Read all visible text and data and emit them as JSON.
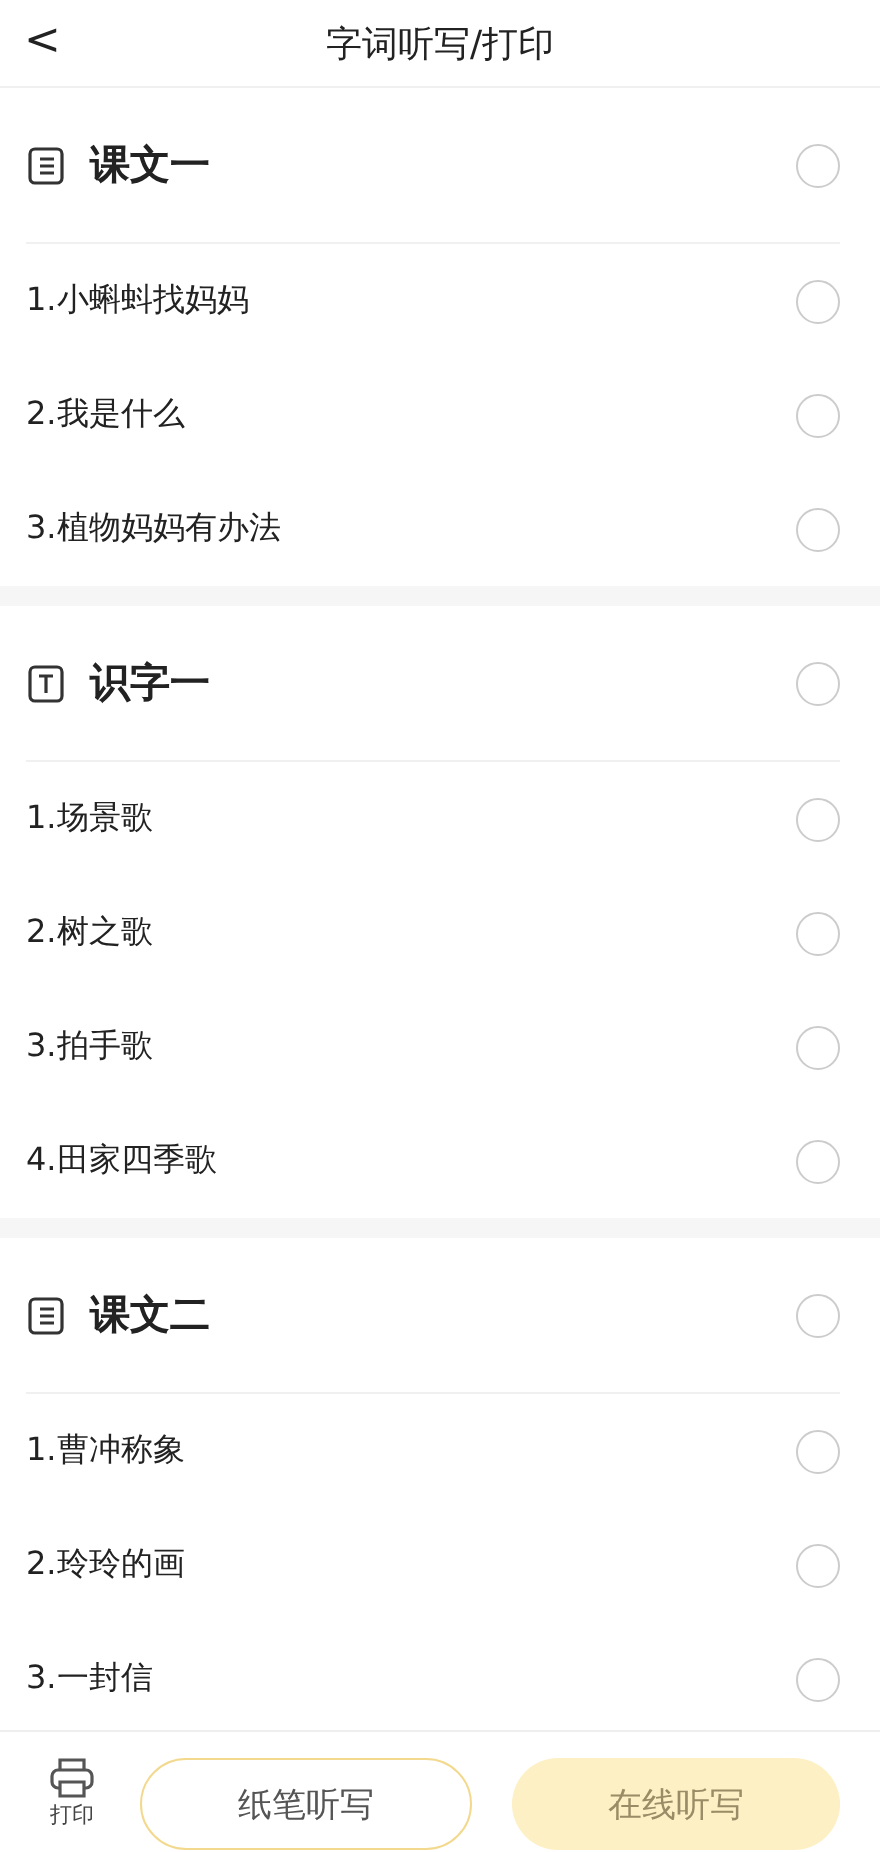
{
  "header": {
    "back": "<",
    "title": "字词听写/打印"
  },
  "sections": [
    {
      "kind": "lesson",
      "title": "课文一",
      "checked": false,
      "items": [
        {
          "label": "1.小蝌蚪找妈妈",
          "checked": false
        },
        {
          "label": "2.我是什么",
          "checked": false
        },
        {
          "label": "3.植物妈妈有办法",
          "checked": false
        }
      ]
    },
    {
      "kind": "literacy",
      "title": "识字一",
      "checked": false,
      "items": [
        {
          "label": "1.场景歌",
          "checked": false
        },
        {
          "label": "2.树之歌",
          "checked": false
        },
        {
          "label": "3.拍手歌",
          "checked": false
        },
        {
          "label": "4.田家四季歌",
          "checked": false
        }
      ]
    },
    {
      "kind": "lesson",
      "title": "课文二",
      "checked": false,
      "items": [
        {
          "label": "1.曹冲称象",
          "checked": false
        },
        {
          "label": "2.玲玲的画",
          "checked": false
        },
        {
          "label": "3.一封信",
          "checked": false
        }
      ]
    }
  ],
  "bottom_bar": {
    "print_label": "打印",
    "paper_button": {
      "label": "纸笔听写",
      "disabled": false
    },
    "online_button": {
      "label": "在线听写",
      "disabled": true
    }
  }
}
